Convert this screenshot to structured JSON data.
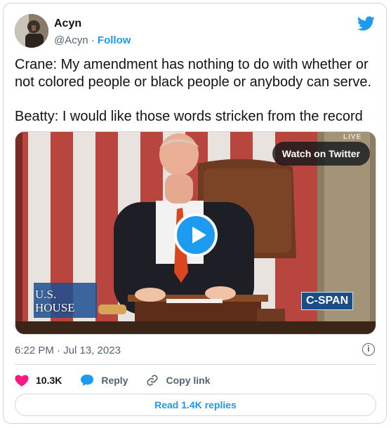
{
  "author": {
    "name": "Acyn",
    "handle": "@Acyn",
    "separator": " · ",
    "follow_label": "Follow"
  },
  "tweet": {
    "lines": [
      "Crane: My amendment has nothing to do with whether or not colored people or black people or anybody can serve.",
      "Beatty: I would like those words stricken from the record"
    ]
  },
  "media": {
    "watch_label": "Watch on Twitter",
    "bug_left_line1": "U.S.",
    "bug_left_line2": "HOUSE",
    "bug_right": "C-SPAN",
    "live_tag": "LIVE"
  },
  "meta": {
    "timestamp": "6:22 PM · Jul 13, 2023"
  },
  "actions": {
    "likes": "10.3K",
    "reply_label": "Reply",
    "copy_label": "Copy link"
  },
  "read_replies_label": "Read 1.4K replies",
  "colors": {
    "accent": "#1d9bf0",
    "like": "#f91880",
    "muted": "#536471",
    "border": "#cfd9de"
  }
}
